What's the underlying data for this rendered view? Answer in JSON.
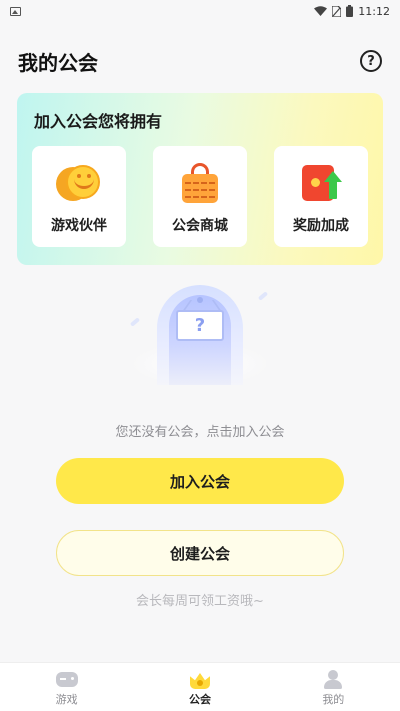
{
  "status_bar": {
    "time": "11:12"
  },
  "header": {
    "title": "我的公会",
    "help_icon": "question-circle-icon",
    "help_glyph": "?"
  },
  "benefits": {
    "title": "加入公会您将拥有",
    "items": [
      {
        "label": "游戏伙伴",
        "icon": "smiling-coins-icon"
      },
      {
        "label": "公会商城",
        "icon": "shopping-bag-icon"
      },
      {
        "label": "奖励加成",
        "icon": "red-envelope-boost-icon"
      }
    ]
  },
  "empty_state": {
    "illustration_glyph": "?",
    "message": "您还没有公会，点击加入公会"
  },
  "actions": {
    "join_label": "加入公会",
    "create_label": "创建公会",
    "hint": "会长每周可领工资哦~"
  },
  "tab_bar": {
    "active": "公会",
    "tabs": [
      {
        "label": "游戏",
        "icon": "gamepad-icon"
      },
      {
        "label": "公会",
        "icon": "crown-icon"
      },
      {
        "label": "我的",
        "icon": "user-icon"
      }
    ]
  },
  "colors": {
    "accent": "#ffe84a",
    "background": "#f7f7f8"
  }
}
